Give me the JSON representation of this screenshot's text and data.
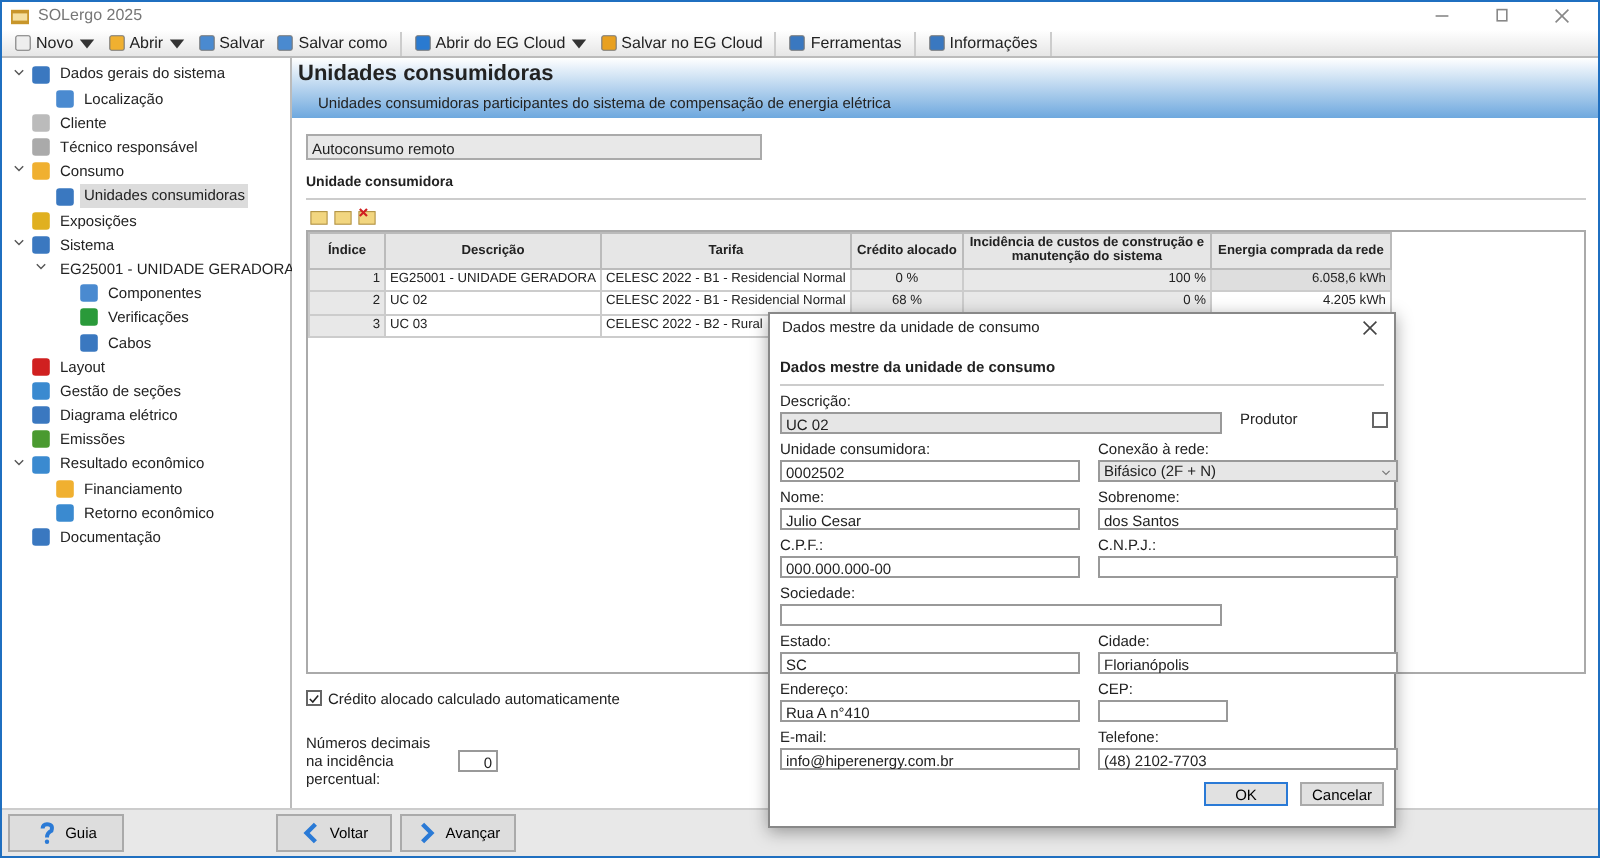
{
  "window": {
    "title": "SOLergo 2025"
  },
  "toolbar": [
    [
      {
        "label": "Novo",
        "dropdown": true
      },
      {
        "label": "Abrir",
        "dropdown": true
      },
      {
        "label": "Salvar",
        "dropdown": false
      },
      {
        "label": "Salvar como",
        "dropdown": false
      }
    ],
    [
      {
        "label": "Abrir do EG Cloud",
        "dropdown": true
      },
      {
        "label": "Salvar no EG Cloud",
        "dropdown": false
      }
    ],
    [
      {
        "label": "Ferramentas",
        "dropdown": false
      }
    ],
    [
      {
        "label": "Informações",
        "dropdown": false
      }
    ]
  ],
  "sidebar": {
    "items": [
      {
        "label": "Dados gerais do sistema",
        "expanded": true,
        "selected": false,
        "children": [
          {
            "label": "Localização",
            "selected": false
          }
        ]
      },
      {
        "label": "Cliente",
        "selected": false
      },
      {
        "label": "Técnico responsável",
        "selected": false
      },
      {
        "label": "Consumo",
        "expanded": true,
        "selected": false,
        "children": [
          {
            "label": "Unidades consumidoras",
            "selected": true
          }
        ]
      },
      {
        "label": "Exposições",
        "selected": false
      },
      {
        "label": "Sistema",
        "expanded": true,
        "selected": false,
        "children": [
          {
            "label": "EG25001 - UNIDADE GERADORA",
            "expanded": true,
            "selected": false,
            "children": [
              {
                "label": "Componentes",
                "selected": false
              },
              {
                "label": "Verificações",
                "selected": false
              },
              {
                "label": "Cabos",
                "selected": false
              }
            ]
          }
        ]
      },
      {
        "label": "Layout",
        "selected": false
      },
      {
        "label": "Gestão de seções",
        "selected": false
      },
      {
        "label": "Diagrama elétrico",
        "selected": false
      },
      {
        "label": "Emissões",
        "selected": false
      },
      {
        "label": "Resultado econômico",
        "expanded": true,
        "selected": false,
        "children": [
          {
            "label": "Financiamento",
            "selected": false
          },
          {
            "label": "Retorno econômico",
            "selected": false
          }
        ]
      },
      {
        "label": "Documentação",
        "selected": false
      }
    ]
  },
  "header": {
    "title": "Unidades consumidoras",
    "subtitle": "Unidades consumidoras participantes do sistema de compensação de energia elétrica"
  },
  "mode_field": {
    "value": "Autoconsumo remoto"
  },
  "section_label": "Unidade consumidora",
  "table": {
    "columns": [
      "Índice",
      "Descrição",
      "Tarifa",
      "Crédito alocado",
      "Incidência de custos de construção e manutenção do sistema",
      "Energia comprada da rede"
    ],
    "rows": [
      {
        "cells": [
          "1",
          "EG25001 - UNIDADE GERADORA",
          "CELESC 2022 - B1 - Residencial Normal",
          "0 %",
          "100 %",
          "6.058,6 kWh"
        ],
        "energy_editable": false
      },
      {
        "cells": [
          "2",
          "UC 02",
          "CELESC 2022 - B1 - Residencial Normal",
          "68 %",
          "0 %",
          "4.205 kWh"
        ],
        "energy_editable": true
      },
      {
        "cells": [
          "3",
          "UC 03",
          "CELESC 2022 - B2 - Rural"
        ]
      }
    ]
  },
  "auto_credit": {
    "label": "Crédito alocado calculado automaticamente",
    "checked": true
  },
  "decimals": {
    "label": "Números decimais na incidência percentual:",
    "value": "0"
  },
  "bottom_buttons": [
    {
      "label": "Guia"
    },
    {
      "label": "Voltar"
    },
    {
      "label": "Avançar"
    }
  ],
  "dialog": {
    "title": "Dados mestre da unidade de consumo",
    "heading": "Dados mestre da unidade de consumo",
    "rows": [
      [
        {
          "kind": "text",
          "label": "Descrição:",
          "value": "UC 02",
          "disabled": true
        },
        {
          "kind": "checkbox",
          "label": "Produtor",
          "checked": false
        }
      ],
      [
        {
          "kind": "text",
          "label": "Unidade consumidora:",
          "value": "0002502",
          "disabled": false
        },
        {
          "kind": "select",
          "label": "Conexão à rede:",
          "value": "Bifásico (2F + N)",
          "disabled": true
        }
      ],
      [
        {
          "kind": "text",
          "label": "Nome:",
          "value": "Julio Cesar",
          "disabled": false
        },
        {
          "kind": "text",
          "label": "Sobrenome:",
          "value": "dos Santos",
          "disabled": false
        }
      ],
      [
        {
          "kind": "text",
          "label": "C.P.F.:",
          "value": "000.000.000-00",
          "disabled": false
        },
        {
          "kind": "text",
          "label": "C.N.P.J.:",
          "disabled": false
        }
      ],
      [
        {
          "kind": "text",
          "label": "Sociedade:",
          "disabled": false
        }
      ],
      [
        {
          "kind": "text",
          "label": "Estado:",
          "value": "SC",
          "disabled": false
        },
        {
          "kind": "text",
          "label": "Cidade:",
          "value": "Florianópolis",
          "disabled": false
        }
      ],
      [
        {
          "kind": "text",
          "label": "Endereço:",
          "value": "Rua A n°410",
          "disabled": false
        },
        {
          "kind": "text",
          "label": "CEP:",
          "disabled": false
        }
      ],
      [
        {
          "kind": "text",
          "label": "E-mail:",
          "value": "info@hiperenergy.com.br",
          "disabled": false
        },
        {
          "kind": "text",
          "label": "Telefone:",
          "value": "(48) 2102-7703",
          "disabled": false
        }
      ]
    ],
    "buttons": [
      {
        "label": "OK",
        "default": true
      },
      {
        "label": "Cancelar",
        "default": false
      }
    ]
  }
}
